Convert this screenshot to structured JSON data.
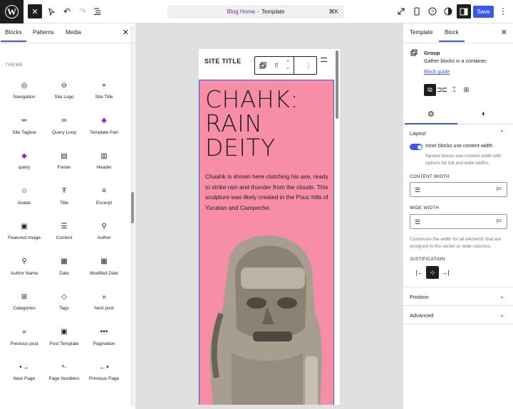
{
  "topbar": {
    "close_icon": "✕",
    "command_page": "Blog Home",
    "command_sep": "·",
    "command_type": "Template",
    "shortcut": "⌘K",
    "save_label": "Save"
  },
  "left_sidebar": {
    "tabs": [
      "Blocks",
      "Patterns",
      "Media"
    ],
    "section_label": "THEME",
    "blocks": [
      {
        "label": "Navigation",
        "icon": "navigation-icon",
        "glyph": "◎"
      },
      {
        "label": "Site Logo",
        "icon": "site-logo-icon",
        "glyph": "⊖"
      },
      {
        "label": "Site Title",
        "icon": "map-marker-icon",
        "glyph": "⌖"
      },
      {
        "label": "Site Tagline",
        "icon": "tagline-icon",
        "glyph": "═"
      },
      {
        "label": "Query Loop",
        "icon": "loop-icon",
        "glyph": "∞"
      },
      {
        "label": "Template Part",
        "icon": "diamond-icon",
        "glyph": "◆",
        "purple": true
      },
      {
        "label": "query",
        "icon": "diamond-icon",
        "glyph": "◆",
        "purple": true
      },
      {
        "label": "Footer",
        "icon": "footer-icon",
        "glyph": "▤"
      },
      {
        "label": "Header",
        "icon": "header-icon",
        "glyph": "▥"
      },
      {
        "label": "Avatar",
        "icon": "avatar-icon",
        "glyph": "☺"
      },
      {
        "label": "Title",
        "icon": "title-icon",
        "glyph": "Ŧ"
      },
      {
        "label": "Excerpt",
        "icon": "excerpt-icon",
        "glyph": "≡"
      },
      {
        "label": "Featured Image",
        "icon": "image-icon",
        "glyph": "▣"
      },
      {
        "label": "Content",
        "icon": "content-icon",
        "glyph": "☰"
      },
      {
        "label": "Author",
        "icon": "author-icon",
        "glyph": "⚲"
      },
      {
        "label": "Author Name",
        "icon": "author-name-icon",
        "glyph": "⚲"
      },
      {
        "label": "Date",
        "icon": "calendar-icon",
        "glyph": "▦"
      },
      {
        "label": "Modified Date",
        "icon": "calendar-icon",
        "glyph": "▦"
      },
      {
        "label": "Categories",
        "icon": "categories-icon",
        "glyph": "⊞"
      },
      {
        "label": "Tags",
        "icon": "tag-icon",
        "glyph": "◇"
      },
      {
        "label": "Next post",
        "icon": "next-icon",
        "glyph": "»"
      },
      {
        "label": "Previous post",
        "icon": "previous-icon",
        "glyph": "«"
      },
      {
        "label": "Post Template",
        "icon": "post-template-icon",
        "glyph": "▣"
      },
      {
        "label": "Pagination",
        "icon": "pagination-icon",
        "glyph": "•••"
      },
      {
        "label": "Next Page",
        "icon": "next-page-icon",
        "glyph": "•→"
      },
      {
        "label": "Page Numbers",
        "icon": "page-numbers-icon",
        "glyph": "ⁿ·"
      },
      {
        "label": "Previous Page",
        "icon": "previous-page-icon",
        "glyph": "←•"
      }
    ]
  },
  "canvas": {
    "site_title": "SITE TITLE",
    "heading": [
      "CHAHK:",
      "RAIN",
      "DEITY"
    ],
    "paragraph": "Chaahk is shown here clutching his axe, ready to strike rain and thunder from the clouds. This sculpture was likely created in the Puuc hills of Yucatan and Campeche.",
    "group_color": "#f78da7"
  },
  "right_sidebar": {
    "tabs": [
      "Template",
      "Block"
    ],
    "block_name": "Group",
    "block_description": "Gather blocks in a container.",
    "block_guide": "Block guide",
    "layout_title": "Layout",
    "toggle_label": "Inner blocks use content width",
    "toggle_help": "Nested blocks use content width with options for full and wide widths.",
    "content_width_label": "CONTENT WIDTH",
    "wide_width_label": "WIDE WIDTH",
    "unit": "px",
    "width_help": "Customize the width for all elements that are assigned to the center or wide columns.",
    "justification_label": "JUSTIFICATION",
    "position_title": "Position",
    "advanced_title": "Advanced"
  },
  "colors": {
    "accent": "#3858e9",
    "dark": "#1e1e1e"
  }
}
